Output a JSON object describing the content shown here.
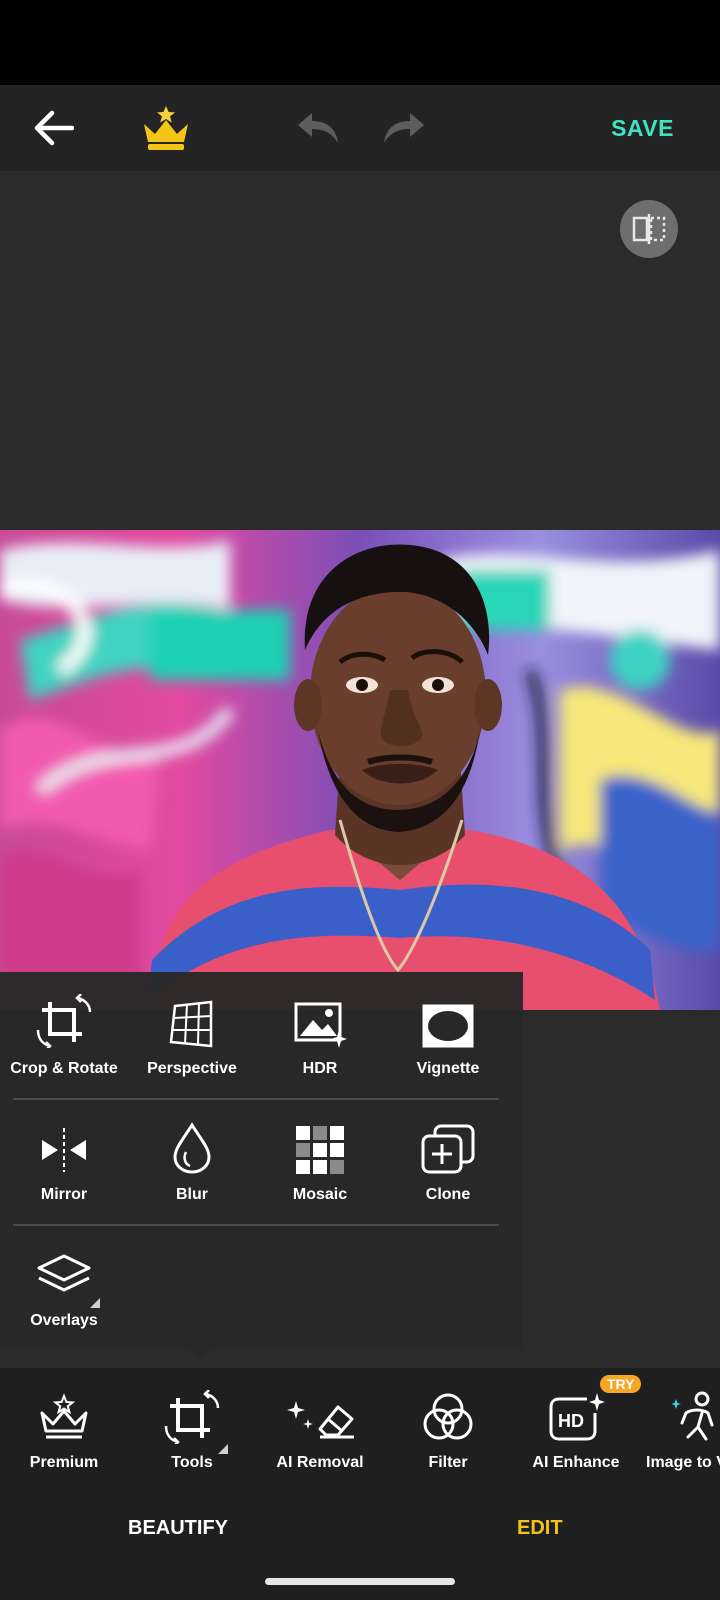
{
  "topbar": {
    "back_icon": "arrow-left-icon",
    "premium_icon": "crown-icon",
    "undo_icon": "undo-icon",
    "redo_icon": "redo-icon",
    "save_label": "SAVE"
  },
  "canvas": {
    "compare_icon": "split-compare-icon"
  },
  "tools_panel": {
    "rows": [
      [
        {
          "label": "Crop & Rotate",
          "icon": "crop-rotate-icon"
        },
        {
          "label": "Perspective",
          "icon": "perspective-grid-icon"
        },
        {
          "label": "HDR",
          "icon": "hdr-image-icon"
        },
        {
          "label": "Vignette",
          "icon": "vignette-icon"
        }
      ],
      [
        {
          "label": "Mirror",
          "icon": "mirror-icon"
        },
        {
          "label": "Blur",
          "icon": "blur-drop-icon"
        },
        {
          "label": "Mosaic",
          "icon": "mosaic-icon"
        },
        {
          "label": "Clone",
          "icon": "clone-icon"
        }
      ],
      [
        {
          "label": "Overlays",
          "icon": "layers-icon"
        }
      ]
    ]
  },
  "bottom_tools": [
    {
      "label": "Premium",
      "icon": "crown-outline-icon"
    },
    {
      "label": "Tools",
      "icon": "crop-rotate-icon"
    },
    {
      "label": "AI Removal",
      "icon": "eraser-sparkle-icon"
    },
    {
      "label": "Filter",
      "icon": "filter-circles-icon"
    },
    {
      "label": "AI Enhance",
      "icon": "hd-sparkle-icon",
      "badge": "TRY"
    },
    {
      "label": "Image to V",
      "icon": "dance-people-icon"
    }
  ],
  "tabs": [
    {
      "label": "BEAUTIFY",
      "active": false
    },
    {
      "label": "EDIT",
      "active": true
    }
  ],
  "colors": {
    "accent_save": "#3fe3c3",
    "active_tab": "#f2c318",
    "badge": "#f5a623"
  }
}
